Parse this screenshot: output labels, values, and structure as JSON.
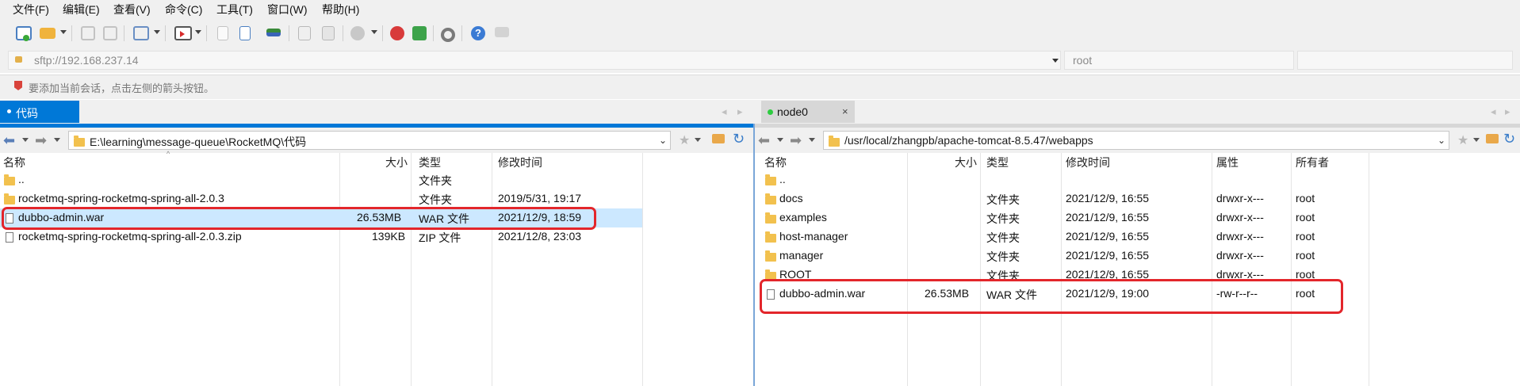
{
  "menu": [
    "文件(F)",
    "编辑(E)",
    "查看(V)",
    "命令(C)",
    "工具(T)",
    "窗口(W)",
    "帮助(H)"
  ],
  "address": {
    "url": "sftp://192.168.237.14",
    "user": "root"
  },
  "hint": "要添加当前会话，点击左侧的箭头按钮。",
  "left": {
    "tab_label": "代码",
    "path": "E:\\learning\\message-queue\\RocketMQ\\代码",
    "columns": {
      "name": "名称",
      "size": "大小",
      "type": "类型",
      "modified": "修改时间"
    },
    "rows": [
      {
        "kind": "folder",
        "name": "..",
        "size": "",
        "type": "文件夹",
        "modified": ""
      },
      {
        "kind": "folder",
        "name": "rocketmq-spring-rocketmq-spring-all-2.0.3",
        "size": "",
        "type": "文件夹",
        "modified": "2019/5/31, 19:17"
      },
      {
        "kind": "file",
        "name": "dubbo-admin.war",
        "size": "26.53MB",
        "type": "WAR 文件",
        "modified": "2021/12/9, 18:59"
      },
      {
        "kind": "file",
        "name": "rocketmq-spring-rocketmq-spring-all-2.0.3.zip",
        "size": "139KB",
        "type": "ZIP 文件",
        "modified": "2021/12/8, 23:03"
      }
    ]
  },
  "right": {
    "tab_label": "node0",
    "path": "/usr/local/zhangpb/apache-tomcat-8.5.47/webapps",
    "columns": {
      "name": "名称",
      "size": "大小",
      "type": "类型",
      "modified": "修改时间",
      "attrs": "属性",
      "owner": "所有者"
    },
    "rows": [
      {
        "kind": "folder",
        "name": "..",
        "size": "",
        "type": "",
        "modified": "",
        "attrs": "",
        "owner": ""
      },
      {
        "kind": "folder",
        "name": "docs",
        "size": "",
        "type": "文件夹",
        "modified": "2021/12/9, 16:55",
        "attrs": "drwxr-x---",
        "owner": "root"
      },
      {
        "kind": "folder",
        "name": "examples",
        "size": "",
        "type": "文件夹",
        "modified": "2021/12/9, 16:55",
        "attrs": "drwxr-x---",
        "owner": "root"
      },
      {
        "kind": "folder",
        "name": "host-manager",
        "size": "",
        "type": "文件夹",
        "modified": "2021/12/9, 16:55",
        "attrs": "drwxr-x---",
        "owner": "root"
      },
      {
        "kind": "folder",
        "name": "manager",
        "size": "",
        "type": "文件夹",
        "modified": "2021/12/9, 16:55",
        "attrs": "drwxr-x---",
        "owner": "root"
      },
      {
        "kind": "folder",
        "name": "ROOT",
        "size": "",
        "type": "文件夹",
        "modified": "2021/12/9, 16:55",
        "attrs": "drwxr-x---",
        "owner": "root"
      },
      {
        "kind": "file",
        "name": "dubbo-admin.war",
        "size": "26.53MB",
        "type": "WAR 文件",
        "modified": "2021/12/9, 19:00",
        "attrs": "-rw-r--r--",
        "owner": "root"
      }
    ]
  },
  "colors": {
    "accent": "#0078d7",
    "selection": "#cce8ff",
    "highlight_box": "#e3262b",
    "connected_dot": "#2ecc40"
  }
}
